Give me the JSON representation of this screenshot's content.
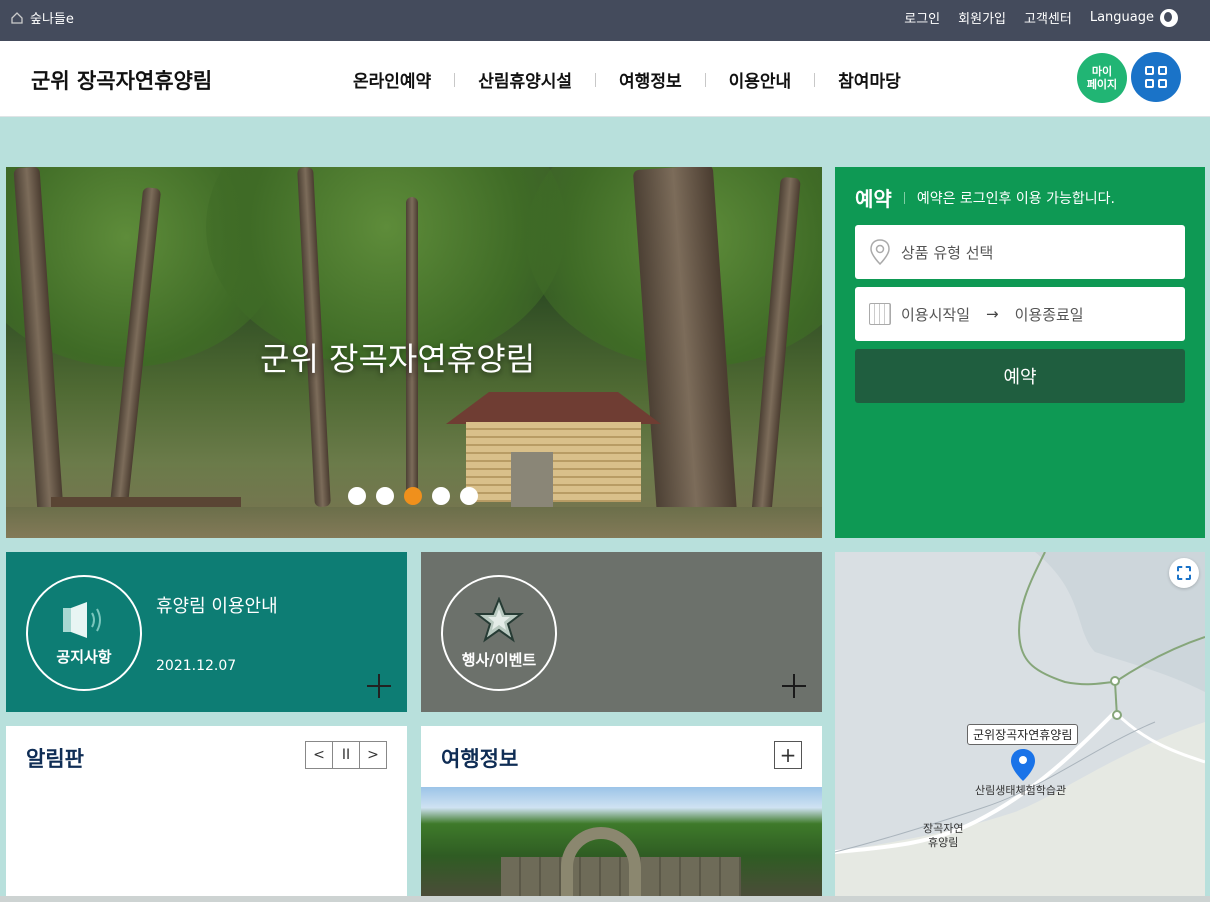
{
  "topbar": {
    "home_label": "숲나들e",
    "links": [
      "로그인",
      "회원가입",
      "고객센터"
    ],
    "language_label": "Language"
  },
  "header": {
    "logo": "군위 장곡자연휴양림",
    "nav": [
      "온라인예약",
      "산림휴양시설",
      "여행정보",
      "이용안내",
      "참여마당"
    ],
    "mypage_line1": "마이",
    "mypage_line2": "페이지"
  },
  "hero": {
    "caption": "군위 장곡자연휴양림",
    "slides_total": 5,
    "active_slide": 3
  },
  "reservation": {
    "title": "예약",
    "desc": "예약은 로그인후 이용 가능합니다.",
    "type_placeholder": "상품 유형 선택",
    "start_label": "이용시작일",
    "arrow": "→",
    "end_label": "이용종료일",
    "button": "예약"
  },
  "notice": {
    "label": "공지사항",
    "title": "휴양림 이용안내",
    "date": "2021.12.07"
  },
  "event": {
    "label": "행사/이벤트"
  },
  "board": {
    "title": "알림판",
    "prev": "<",
    "pause": "II",
    "next": ">"
  },
  "travel": {
    "title": "여행정보",
    "more": "+"
  },
  "map": {
    "place_label": "군위장곡자연휴양림",
    "poi1": "산림생태체험학습관",
    "poi2_line1": "장곡자연",
    "poi2_line2": "휴양림"
  },
  "colors": {
    "topbar": "#444b5c",
    "reserve_green": "#0e9954",
    "notice_teal": "#0d7d74",
    "event_gray": "#6c716b",
    "page_bg": "#b8e0dc",
    "active_dot": "#f0901c"
  }
}
